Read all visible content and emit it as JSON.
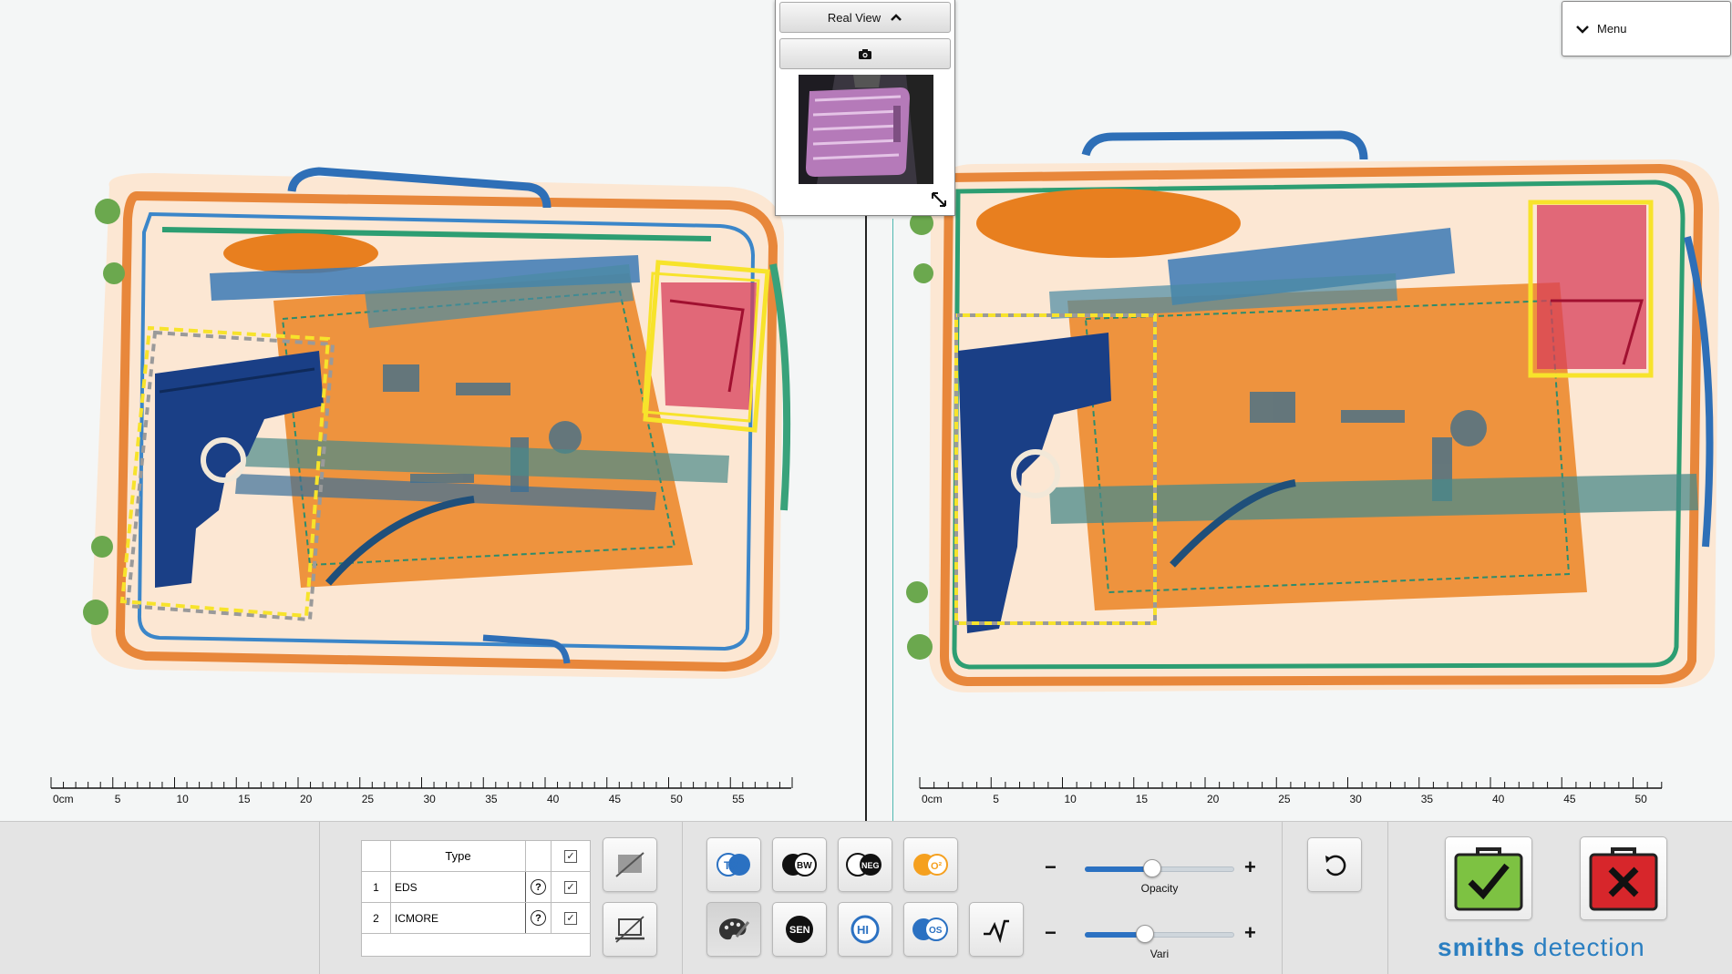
{
  "realview": {
    "title": "Real View",
    "camera_icon": "camera-icon",
    "thumbnail": "suitcase-photo",
    "expand_icon": "expand-icon"
  },
  "menu": {
    "label": "Menu",
    "icon": "chevron-down-icon"
  },
  "rulers": {
    "left": {
      "unit_label": "0cm",
      "labels": [
        "5",
        "10",
        "15",
        "20",
        "25",
        "30",
        "35",
        "40",
        "45",
        "50",
        "55"
      ]
    },
    "right": {
      "unit_label": "0cm",
      "labels": [
        "5",
        "10",
        "15",
        "20",
        "25",
        "30",
        "35",
        "40",
        "45",
        "50"
      ]
    }
  },
  "detections": {
    "header": {
      "type": "Type"
    },
    "rows": [
      {
        "num": "1",
        "type": "EDS"
      },
      {
        "num": "2",
        "type": "ICMORE"
      }
    ]
  },
  "tools": {
    "ts": "TS",
    "bw": "BW",
    "neg": "NEG",
    "o2": "O²",
    "sen": "SEN",
    "hi": "HI",
    "os": "OS"
  },
  "sliders": {
    "opacity": {
      "label": "Opacity",
      "value": 0.45,
      "minus": "−",
      "plus": "+"
    },
    "vari": {
      "label": "Vari",
      "value": 0.4,
      "minus": "−",
      "plus": "+"
    }
  },
  "brand": {
    "part1": "smiths",
    "part2": " detection"
  },
  "colors": {
    "accent": "#2b71c2",
    "clear": "#7dc242",
    "alarm": "#d7262b",
    "brand": "#2b7fc1"
  }
}
